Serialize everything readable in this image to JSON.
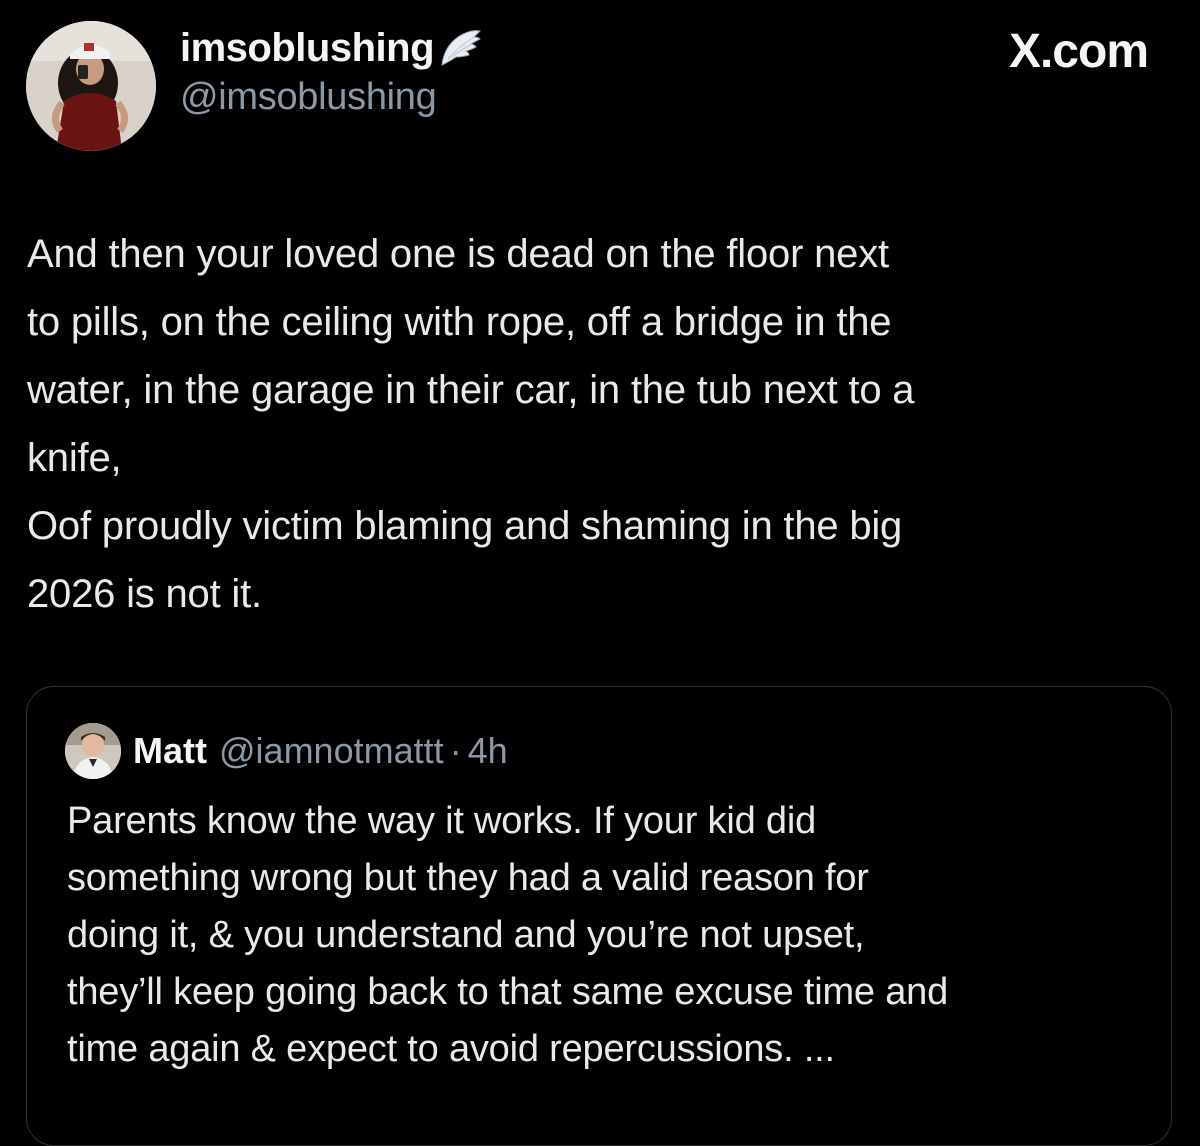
{
  "author": {
    "display_name": "imsoblushing",
    "badge_icon": "angel-wing-icon",
    "handle": "@imsoblushing",
    "avatar_icon": "profile-photo-avatar"
  },
  "brand": {
    "label": "X.com"
  },
  "tweet": {
    "lines": [
      "And then your loved one is dead on the floor next",
      "to pills, on the ceiling with rope, off a bridge in the",
      "water, in the garage in their car, in the tub next to a",
      "knife,",
      "Oof proudly victim blaming and shaming in the big",
      "2026 is not it."
    ]
  },
  "quoted_tweet": {
    "display_name": "Matt",
    "handle": "@iamnotmattt",
    "separator": "·",
    "time": "4h",
    "avatar_icon": "profile-photo-avatar",
    "lines": [
      "Parents know the way it works. If your kid did",
      "something wrong but they had a valid reason for",
      "doing it, & you understand and you’re not upset,",
      "they’ll keep going back to that same excuse time and",
      "time again & expect to avoid repercussions. ..."
    ]
  },
  "colors": {
    "background": "#000000",
    "primary_text": "#e7e9ea",
    "secondary_text": "#8b98a5",
    "card_border": "#2f3336"
  }
}
